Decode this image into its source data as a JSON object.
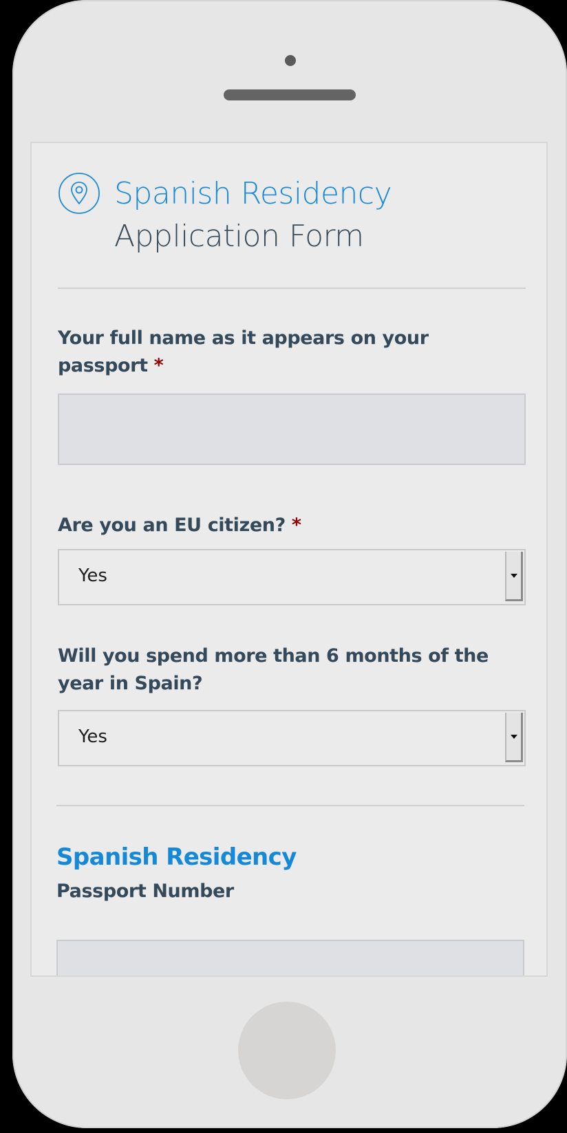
{
  "form": {
    "title_line1": "Spanish Residency",
    "title_line2": "Application Form",
    "icon": "location-pin-icon",
    "fields": [
      {
        "label": "Your full name as it appears on your passport",
        "required_mark": "*",
        "type": "text",
        "value": ""
      },
      {
        "label": "Are you an EU citizen?",
        "required_mark": "*",
        "type": "select",
        "value": "Yes"
      },
      {
        "label": "Will you spend more than 6 months of the year in Spain?",
        "type": "select",
        "value": "Yes"
      }
    ],
    "section": {
      "title": "Spanish Residency",
      "field_label": "Passport Number",
      "field_value": ""
    }
  },
  "colors": {
    "accent": "#1d8ad6",
    "label_text": "#34495a",
    "required": "#8f0000",
    "phone_body": "#e6e6e6"
  }
}
